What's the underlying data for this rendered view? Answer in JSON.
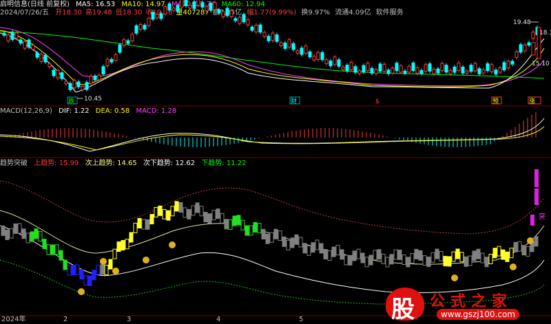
{
  "colors": {
    "up": "#ff3b3b",
    "down": "#00ffff",
    "ma5": "#ffffff",
    "ma10": "#ffff00",
    "ma20": "#ff44ff",
    "ma60": "#00ff00",
    "grid": "#7a0000"
  },
  "header": {
    "stock": "启明信息(日线 前复权)",
    "date": "2024/07/26/五",
    "open": "开18.30",
    "high": "高19.48",
    "low": "低18.30",
    "close": "收19.48",
    "volume": "量407287",
    "amount": "额7.85亿",
    "change": "幅1.77(9.99%)",
    "turnover": "换9.97%",
    "float": "流通4.09亿",
    "sector": "软件服务"
  },
  "ma_legend": {
    "ma5": "MA5: 16.53",
    "ma10": "MA10: 14.97",
    "ma20": "MA20: 13.74",
    "ma60": "MA60: 12.94"
  },
  "price_labels": {
    "high": "19.48",
    "right1": "18.30",
    "right2": "15.10",
    "low": "10.45"
  },
  "event_tags": [
    "跌",
    "财",
    "$",
    "预",
    "涨"
  ],
  "macd": {
    "title": "MACD(12,26,9)",
    "dif": "DIF: 1.22",
    "dea": "DEA: 0.58",
    "macd": "MACD: 1.28"
  },
  "trend": {
    "title": "趋势突破",
    "upper": "上趋势: 15.99",
    "upper2": "次上趋势: 14.65",
    "lower2": "次下趋势: 12.62",
    "lower": "下趋势: 11.22",
    "tag": "突"
  },
  "axis_dates": [
    "2024年",
    "2",
    "3",
    "4",
    "5"
  ],
  "watermark": {
    "logo": "股",
    "text": "公式之家",
    "url": "www.gszj100.com"
  }
}
